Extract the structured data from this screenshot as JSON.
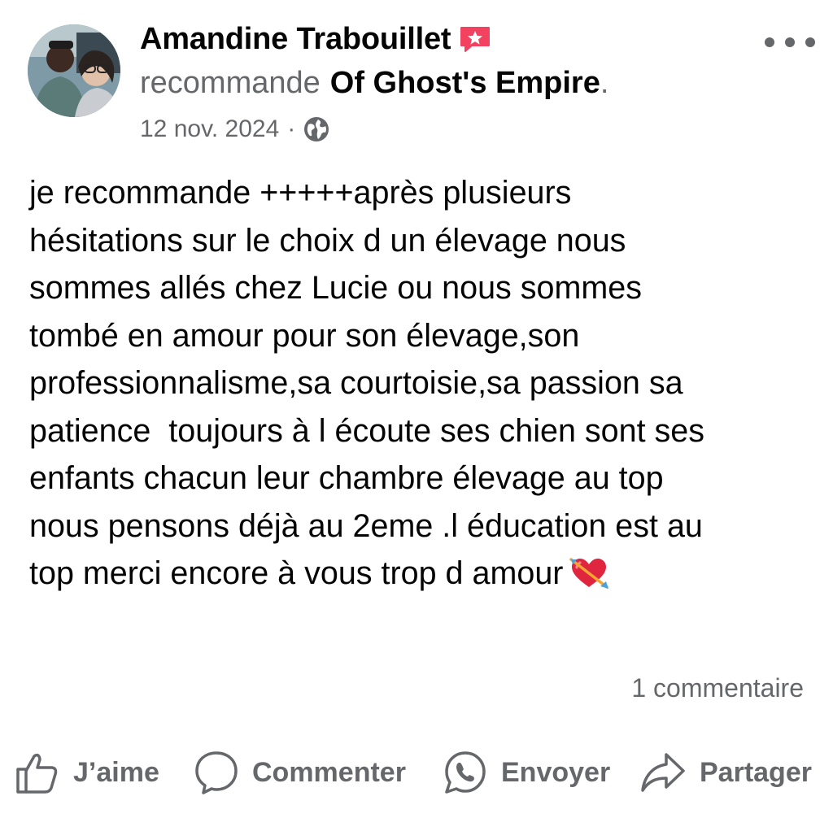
{
  "post": {
    "author": "Amandine Trabouillet",
    "recommends_verb": "recommande",
    "page_name": "Of Ghost's Empire",
    "trailing_dot": ".",
    "date": "12 nov. 2024",
    "separator": "·",
    "audience_icon": "globe-icon",
    "badge_icon": "recommendation-badge-icon",
    "text_lines": [
      "je recommande +++++après plusieurs",
      "hésitations sur le choix d un élevage nous",
      "sommes allés chez Lucie ou nous sommes",
      "tombé en amour pour son élevage,son",
      "professionnalisme,sa courtoisie,sa passion sa",
      "patience  toujours à l écoute ses chien sont ses",
      "enfants chacun leur chambre élevage au top",
      "nous pensons déjà au 2eme .l éducation est au",
      "top merci encore à vous trop d amour"
    ],
    "emoji_icon": "heart-with-arrow-icon",
    "comment_count": "1 commentaire"
  },
  "actions": {
    "like": "J’aime",
    "comment": "Commenter",
    "send": "Envoyer",
    "share": "Partager"
  },
  "colors": {
    "primary_text": "#050505",
    "secondary_text": "#65676b",
    "badge": "#f3425f"
  }
}
